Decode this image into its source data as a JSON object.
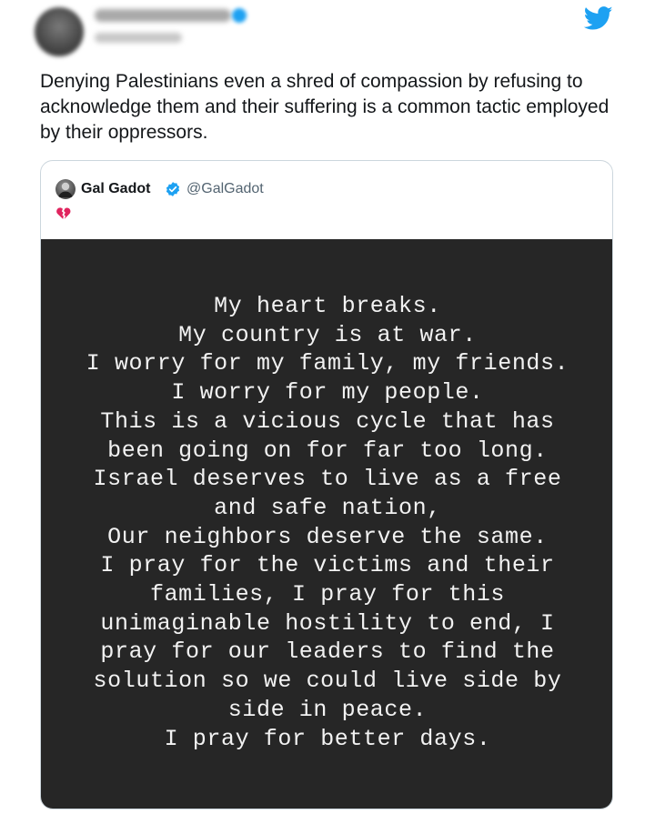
{
  "tweet": {
    "text": "Denying Palestinians even a shred of compassion by refusing to acknowledge them and their suffering is a common tactic employed by their oppressors."
  },
  "quoted_tweet": {
    "name": "Gal Gadot",
    "handle": "@GalGadot",
    "emoji": "broken-heart",
    "story_lines": [
      "My heart breaks.",
      "My country is at war.",
      "I worry for my family, my friends.",
      "I worry for my people.",
      "This is a vicious cycle that has",
      "been going on for far too long.",
      "Israel deserves to live as a free",
      "and safe nation,",
      "Our neighbors deserve the same.",
      "I pray for the victims and their",
      "families, I pray for this",
      "unimaginable hostility to end, I",
      "pray for our leaders to find the",
      "solution so we could live side by",
      "side in peace.",
      "I pray for better days."
    ]
  },
  "colors": {
    "twitter_blue": "#1da1f2",
    "story_background": "#262626",
    "story_text": "#f2f2f2",
    "broken_heart": "#e0245e"
  }
}
